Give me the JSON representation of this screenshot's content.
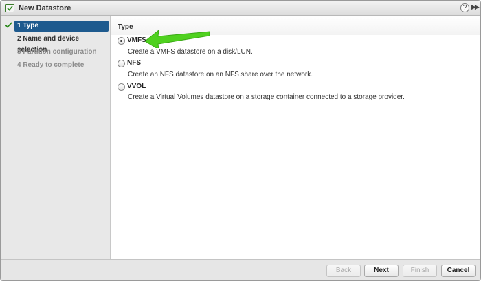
{
  "window": {
    "title": "New Datastore",
    "help_label": "?",
    "expand_label": "▶▶"
  },
  "sidebar": {
    "steps": [
      {
        "label": "1  Type",
        "state": "active",
        "completed": true
      },
      {
        "label": "2  Name and device selection",
        "state": "enabled"
      },
      {
        "label": "3  Partition configuration",
        "state": "disabled"
      },
      {
        "label": "4  Ready to complete",
        "state": "disabled"
      }
    ]
  },
  "main": {
    "section_title": "Type",
    "options": [
      {
        "label": "VMFS",
        "description": "Create a VMFS datastore on a disk/LUN.",
        "selected": true
      },
      {
        "label": "NFS",
        "description": "Create an NFS datastore on an NFS share over the network.",
        "selected": false
      },
      {
        "label": "VVOL",
        "description": "Create a Virtual Volumes datastore on a storage container connected to a storage provider.",
        "selected": false
      }
    ]
  },
  "footer": {
    "back_label": "Back",
    "next_label": "Next",
    "finish_label": "Finish",
    "cancel_label": "Cancel"
  },
  "colors": {
    "accent": "#1e5a8e",
    "annotation_arrow": "#4fd11f"
  }
}
